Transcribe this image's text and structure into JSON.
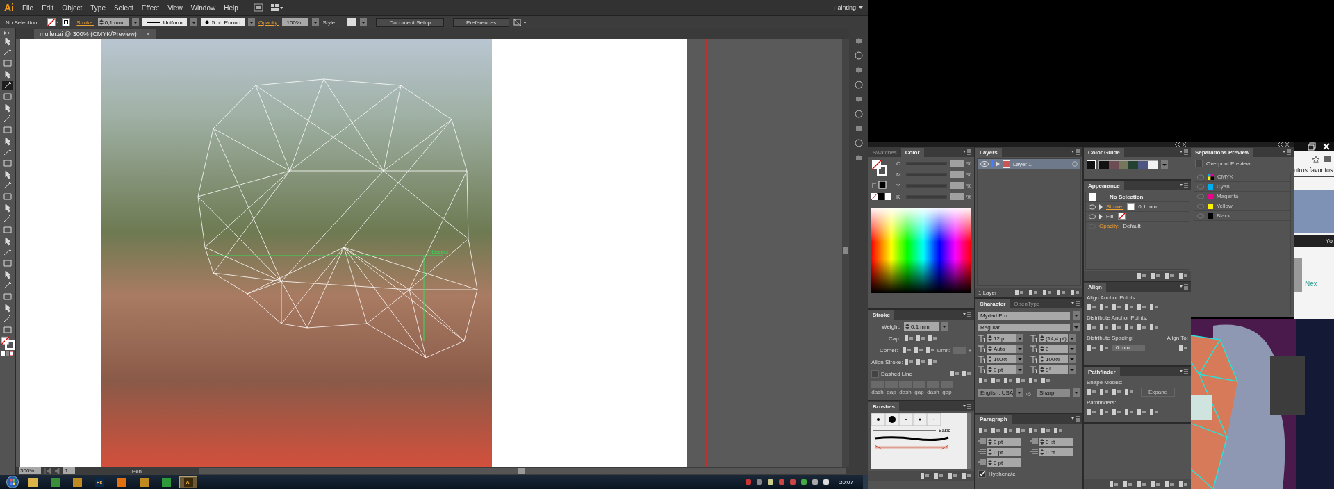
{
  "menu_bar": {
    "logo": "Ai",
    "items": [
      "File",
      "Edit",
      "Object",
      "Type",
      "Select",
      "Effect",
      "View",
      "Window",
      "Help"
    ],
    "workspace": "Painting"
  },
  "control_bar": {
    "selection": "No Selection",
    "stroke_label": "Stroke:",
    "stroke_weight": "0,1 mm",
    "profile": "Uniform",
    "brush": "5 pt. Round",
    "opacity_label": "Opacity:",
    "opacity": "100%",
    "style_label": "Style:",
    "buttons": [
      "Document Setup",
      "Preferences"
    ]
  },
  "document_tab": {
    "title": "muller.ai @ 300% (CMYK/Preview)",
    "close": "×"
  },
  "tools": [
    {
      "selected": false
    },
    {
      "selected": false
    },
    {
      "selected": false
    },
    {
      "selected": false
    },
    {
      "selected": true
    },
    {
      "selected": false
    },
    {
      "selected": false
    },
    {
      "selected": false
    },
    {
      "selected": false
    },
    {
      "selected": false
    },
    {
      "selected": false
    },
    {
      "selected": false
    },
    {
      "selected": false
    },
    {
      "selected": false
    },
    {
      "selected": false
    },
    {
      "selected": false
    },
    {
      "selected": false
    },
    {
      "selected": false
    },
    {
      "selected": false
    },
    {
      "selected": false
    },
    {
      "selected": false
    },
    {
      "selected": false
    },
    {
      "selected": false
    },
    {
      "selected": false
    },
    {
      "selected": false
    },
    {
      "selected": false
    },
    {
      "selected": false
    }
  ],
  "canvas": {
    "smart_guide": "intersect"
  },
  "status_bar": {
    "zoom": "300%",
    "artboard": "1",
    "tool": "Pen"
  },
  "color_panel": {
    "tabs": [
      {
        "label": "Swatches",
        "selected": false
      },
      {
        "label": "Color",
        "selected": true
      }
    ],
    "channels": [
      {
        "name": "C",
        "unit": "%"
      },
      {
        "name": "M",
        "unit": "%"
      },
      {
        "name": "Y",
        "unit": "%"
      },
      {
        "name": "K",
        "unit": "%"
      }
    ]
  },
  "stroke_panel": {
    "title": "Stroke",
    "weight_label": "Weight:",
    "weight": "0,1 mm",
    "cap_label": "Cap:",
    "corner_label": "Corner:",
    "limit_label": "Limit:",
    "limit_unit": "x",
    "align_label": "Align Stroke:",
    "dashed_label": "Dashed Line",
    "dashed": false,
    "dash_labels": [
      "dash",
      "gap",
      "dash",
      "gap",
      "dash",
      "gap"
    ]
  },
  "brushes_panel": {
    "title": "Brushes",
    "basic": "Basic"
  },
  "layers_panel": {
    "title": "Layers",
    "layers": [
      {
        "name": "Layer 1",
        "visible": true,
        "selected": true
      }
    ],
    "count": "1 Layer"
  },
  "character_panel": {
    "tabs": [
      {
        "label": "Character",
        "selected": true
      },
      {
        "label": "OpenType",
        "selected": false
      }
    ],
    "font": "Myriad Pro",
    "style": "Regular",
    "fields": [
      "12 pt",
      "(14,4 pt)",
      "Auto",
      "0",
      "100%",
      "100%",
      "0 pt",
      "0°"
    ],
    "language": "English: USA",
    "antialias": "Sharp"
  },
  "paragraph_panel": {
    "title": "Paragraph",
    "fields": [
      "0 pt",
      "0 pt",
      "0 pt",
      "0 pt",
      "0 pt"
    ],
    "hyphenate_label": "Hyphenate",
    "hyphenate": true
  },
  "color_guide_panel": {
    "title": "Color Guide",
    "colors": [
      {
        "color": "#111111"
      },
      {
        "color": "#6e4c54"
      },
      {
        "color": "#76765e"
      },
      {
        "color": "#244232"
      },
      {
        "color": "#4c5680"
      },
      {
        "color": "#f2f2f2"
      }
    ]
  },
  "appearance_panel": {
    "title": "Appearance",
    "selection": "No Selection",
    "rows": [
      {
        "kind": "stroke",
        "label": "Stroke:",
        "value": "0,1 mm"
      },
      {
        "kind": "fill",
        "label": "Fill:"
      },
      {
        "kind": "opacity",
        "label": "Opacity:",
        "value": "Default"
      }
    ]
  },
  "align_panel": {
    "title": "Align",
    "anchor_label": "Align Anchor Points:",
    "distribute_label": "Distribute Anchor Points:",
    "spacing_label": "Distribute Spacing:",
    "align_to_label": "Align To:",
    "spacing": "0 mm"
  },
  "pathfinder_panel": {
    "title": "Pathfinder",
    "shape_modes_label": "Shape Modes:",
    "expand": "Expand",
    "pathfinders_label": "Pathfinders:"
  },
  "separations_panel": {
    "title": "Separations Preview",
    "overprint_label": "Overprint Preview",
    "overprint": false,
    "plates": [
      {
        "kind": "composite",
        "name": "CMYK"
      },
      {
        "kind": "plate",
        "name": "Cyan",
        "color": "#00aeef"
      },
      {
        "kind": "plate",
        "name": "Magenta",
        "color": "#ec008c"
      },
      {
        "kind": "plate",
        "name": "Yellow",
        "color": "#fff200"
      },
      {
        "kind": "plate",
        "name": "Black",
        "color": "#000000"
      }
    ]
  },
  "browser": {
    "bookmarks": "utros favoritos",
    "video_text": "Yo",
    "tile_text": "Nex"
  },
  "taskbar": {
    "buttons": [
      {
        "kind": "folder",
        "selected": false
      },
      {
        "kind": "browser",
        "selected": false
      },
      {
        "kind": "app",
        "selected": false
      },
      {
        "kind": "ps",
        "label": "Ps",
        "selected": false
      },
      {
        "kind": "cone",
        "selected": false
      },
      {
        "kind": "app",
        "selected": false
      },
      {
        "kind": "globe",
        "selected": false
      },
      {
        "kind": "ai",
        "label": "Ai",
        "selected": true
      }
    ],
    "clock": "20:07"
  }
}
